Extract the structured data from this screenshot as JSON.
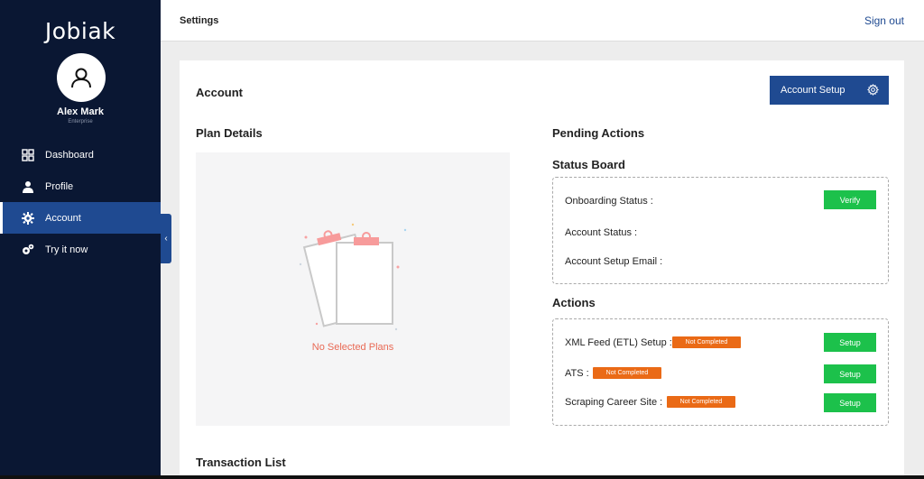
{
  "sidebar": {
    "brand": "Jobiak",
    "user": {
      "name": "Alex Mark",
      "role": "Enterprise"
    },
    "items": [
      {
        "label": "Dashboard",
        "icon": "dashboard-icon"
      },
      {
        "label": "Profile",
        "icon": "user-icon"
      },
      {
        "label": "Account",
        "icon": "gear-icon",
        "active": true
      },
      {
        "label": "Try it now",
        "icon": "gears-icon"
      }
    ]
  },
  "topbar": {
    "title": "Settings",
    "signout": "Sign out"
  },
  "account": {
    "title": "Account",
    "setup_button": "Account Setup"
  },
  "plan": {
    "title": "Plan Details",
    "empty_text": "No Selected Plans"
  },
  "pending": {
    "title": "Pending Actions",
    "status_board": {
      "title": "Status Board",
      "rows": [
        {
          "label": "Onboarding Status :",
          "button": "Verify"
        },
        {
          "label": "Account Status :"
        },
        {
          "label": "Account Setup Email :"
        }
      ]
    },
    "actions": {
      "title": "Actions",
      "rows": [
        {
          "label": "XML Feed (ETL) Setup :",
          "badge": "Not Completed",
          "button": "Setup"
        },
        {
          "label": "ATS :",
          "badge": "Not Completed",
          "button": "Setup"
        },
        {
          "label": "Scraping Career Site :",
          "badge": "Not Completed",
          "button": "Setup"
        }
      ]
    }
  },
  "transactions": {
    "title": "Transaction List"
  },
  "colors": {
    "sidebar_bg": "#0a1733",
    "accent": "#1f4a91",
    "success": "#1cc14b",
    "warning": "#ea6a16",
    "empty_text": "#e96a55"
  }
}
